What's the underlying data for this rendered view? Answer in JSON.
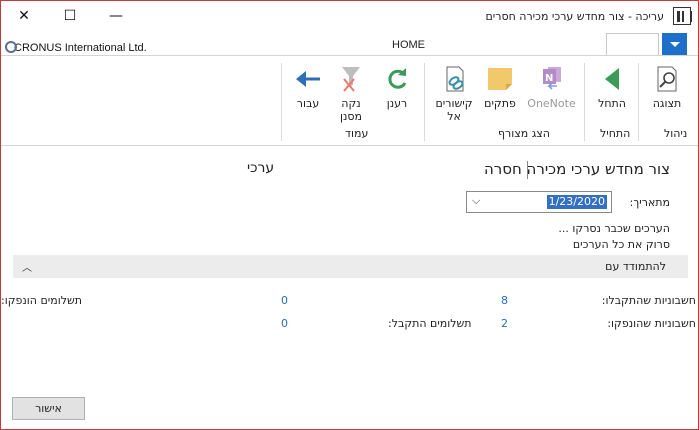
{
  "window": {
    "title": "עריכה - צור מחדש ערכי מכירה חסרים",
    "minimize_glyph": "—",
    "maximize_glyph": "☐",
    "close_glyph": "✕"
  },
  "header": {
    "company": "CRONUS International Ltd.",
    "tab_home": "HOME"
  },
  "ribbon": {
    "groups": [
      {
        "label": "ניהול",
        "items": [
          {
            "label": "תצוגה",
            "icon": "magnifier-icon"
          }
        ]
      },
      {
        "label": "התחיל",
        "items": [
          {
            "label": "התחל",
            "icon": "play-icon"
          }
        ]
      },
      {
        "label": "הצג מצורף",
        "items": [
          {
            "label": "OneNote",
            "icon": "onenote-icon"
          },
          {
            "label": "פתקים",
            "icon": "notes-icon"
          },
          {
            "label": "קישורים אל",
            "icon": "links-icon"
          }
        ]
      },
      {
        "label": "עמוד",
        "items": [
          {
            "label": "רענן",
            "icon": "refresh-icon"
          },
          {
            "label": "נקה מסנן",
            "icon": "clear-filter-icon"
          },
          {
            "label": "עבור",
            "icon": "go-arrow-icon"
          }
        ]
      }
    ]
  },
  "page": {
    "title": "צור מחדש ערכי מכירה חסרה",
    "subtitle": "ערכי",
    "date_label": "מתאריך:",
    "date_value": "1/23/2020",
    "scanned_text": "הערכים שכבר נסרקו ...",
    "scan_all_text": "סרוק את כל הערכים",
    "section_title": "להתמודד עם",
    "rows": [
      {
        "label": "חשבוניות שהתקבלו:",
        "value": "8",
        "right_label": "תשלומים הונפקו:",
        "right_value": "0"
      },
      {
        "label": "חשבוניות שהונפקו:",
        "value": "2",
        "right_label": "תשלומים התקבל:",
        "right_value": "0"
      }
    ]
  },
  "footer": {
    "ok_label": "אישור"
  }
}
